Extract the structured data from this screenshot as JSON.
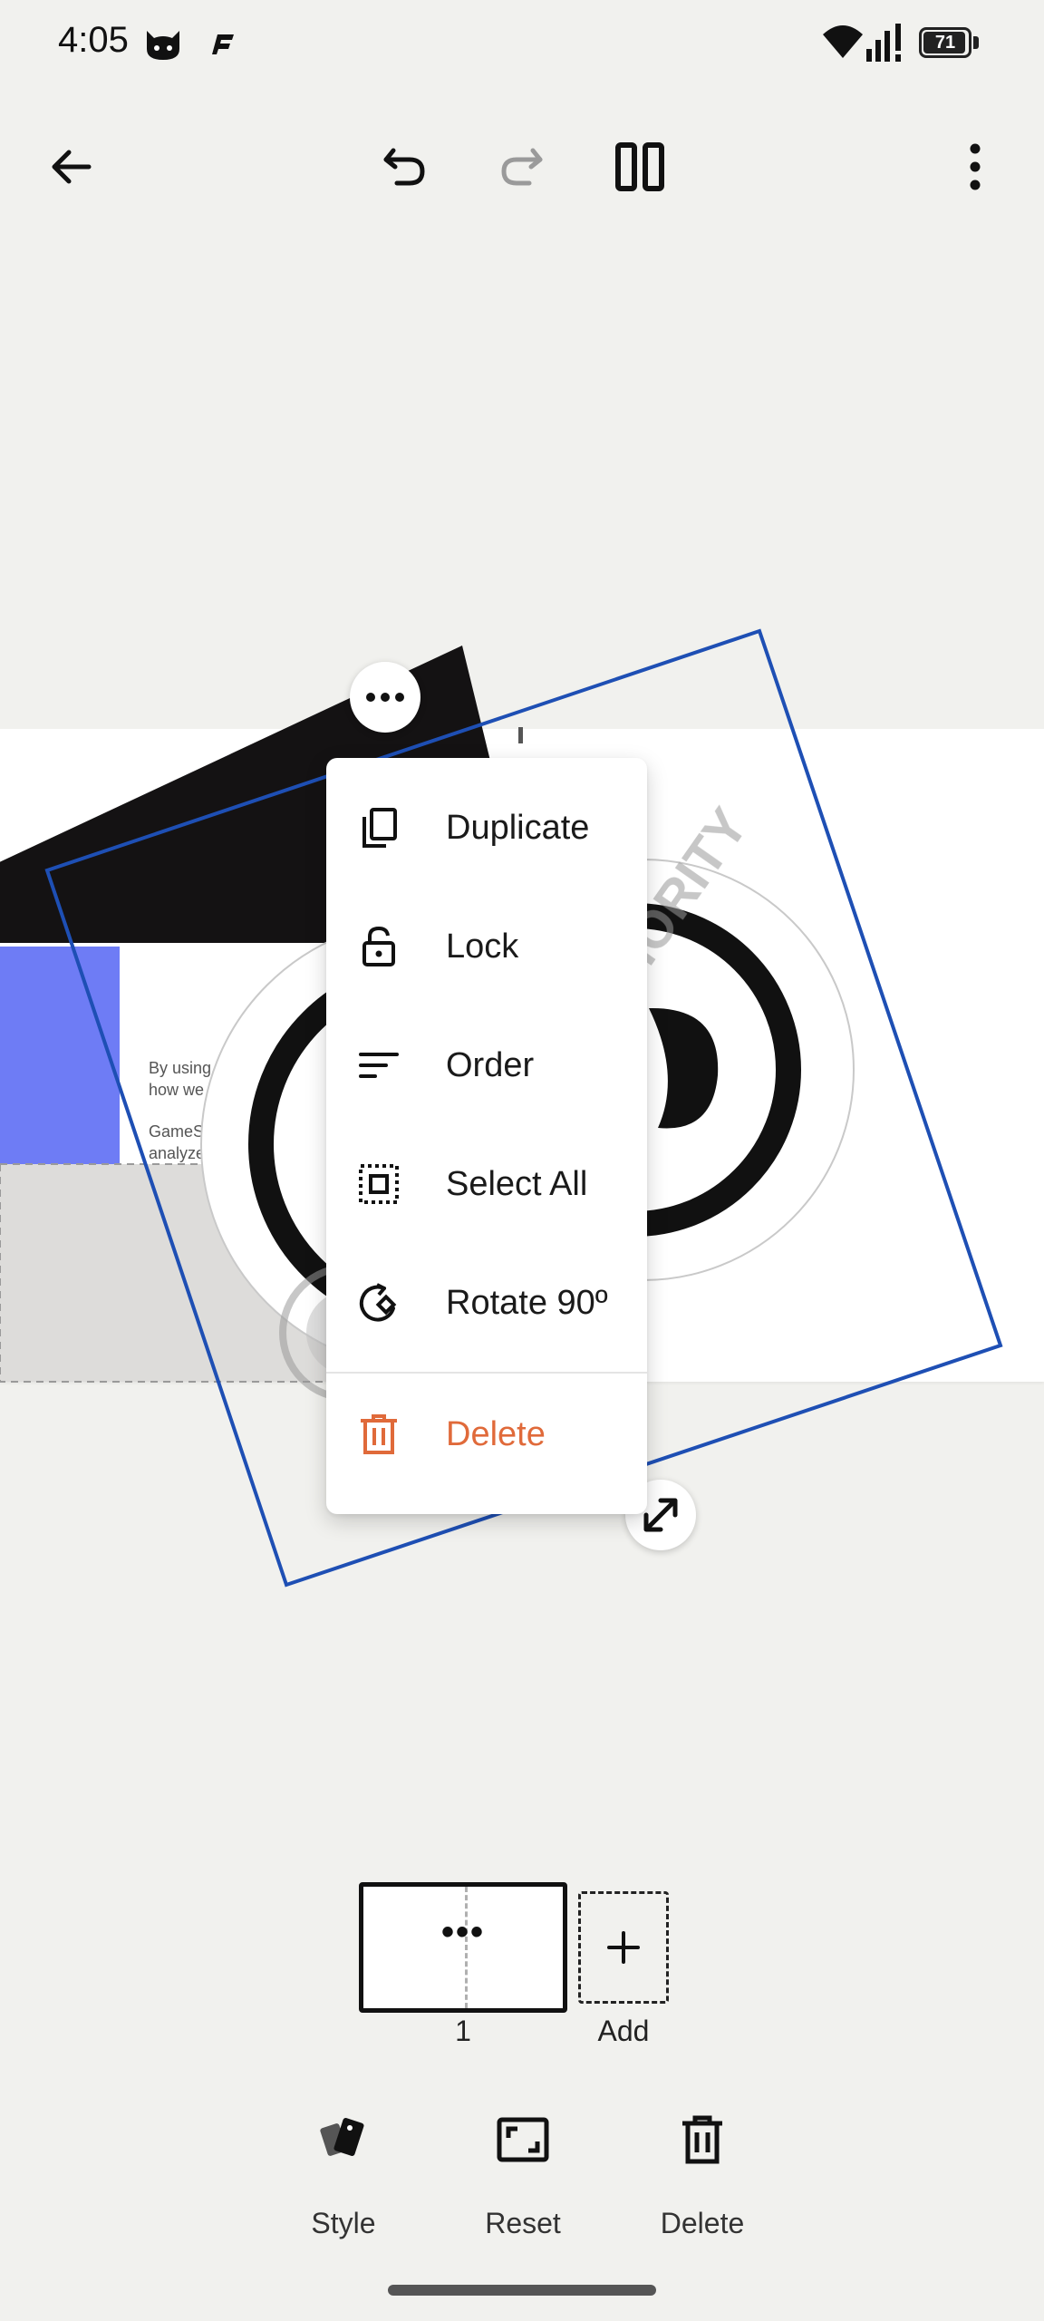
{
  "status_bar": {
    "time": "4:05",
    "battery": "71",
    "icons": [
      "cat-icon",
      "f-icon",
      "wifi-icon",
      "signal-icon",
      "battery-icon"
    ]
  },
  "toolbar": {
    "buttons": [
      "back-arrow-icon",
      "undo-icon",
      "redo-icon",
      "pause-icon",
      "overflow-menu-icon"
    ]
  },
  "context_menu": {
    "items": [
      {
        "label": "Duplicate",
        "icon": "duplicate-icon"
      },
      {
        "label": "Lock",
        "icon": "lock-icon"
      },
      {
        "label": "Order",
        "icon": "order-icon"
      },
      {
        "label": "Select All",
        "icon": "select-all-icon"
      },
      {
        "label": "Rotate 90º",
        "icon": "rotate-icon"
      },
      {
        "label": "Delete",
        "icon": "delete-icon",
        "color": "#e06a3a"
      }
    ]
  },
  "canvas": {
    "card_text_line1": "By using",
    "card_text_line2": "how we",
    "card_text_line3": "GameS",
    "card_text_line4": "analyze",
    "watermark": "ANDROID AUTHORITY",
    "selection_color": "#1e4fb4",
    "accent_block_color": "#6e7cf5"
  },
  "pages": {
    "current_page": "1",
    "add_label": "Add"
  },
  "bottom_toolbar": {
    "style_label": "Style",
    "reset_label": "Reset",
    "delete_label": "Delete"
  }
}
